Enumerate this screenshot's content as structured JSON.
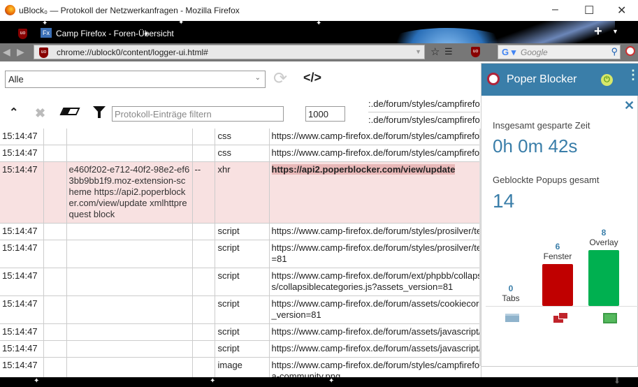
{
  "window": {
    "title": "uBlock₀ — Protokoll der Netzwerkanfragen - Mozilla Firefox",
    "minimize": "–",
    "maximize": "☐",
    "close": "✕"
  },
  "tab": {
    "label": "Camp Firefox - Foren-Übersicht",
    "new_tab": "+"
  },
  "navbar": {
    "url": "chrome://ublock0/content/logger-ui.html#",
    "search_placeholder": "Google"
  },
  "logger": {
    "select_value": "Alle",
    "filter_placeholder": "Protokoll-Einträge filtern",
    "max_entries": "1000",
    "partial_urls": [
      ":.de/forum/styles/campfirefox",
      ":.de/forum/styles/campfirefox"
    ],
    "rows": [
      {
        "time": "15:14:47",
        "context": "",
        "flag": "",
        "type": "css",
        "url": "https://www.camp-firefox.de/forum/styles/campfirefox",
        "blocked": false
      },
      {
        "time": "15:14:47",
        "context": "",
        "flag": "",
        "type": "css",
        "url": "https://www.camp-firefox.de/forum/styles/campfirefox",
        "blocked": false
      },
      {
        "time": "15:14:47",
        "context": "e460f202-e712-40f2-98e2-ef63bb9bb1f9.moz-extension-scheme https://api2.poperblocker.com/view/update xmlhttprequest block",
        "flag": "--",
        "type": "xhr",
        "url": "https://api2.poperblocker.com/view/update",
        "blocked": true
      },
      {
        "time": "15:14:47",
        "context": "",
        "flag": "",
        "type": "script",
        "url": "https://www.camp-firefox.de/forum/styles/prosilver/te",
        "blocked": false
      },
      {
        "time": "15:14:47",
        "context": "",
        "flag": "",
        "type": "script",
        "url": "https://www.camp-firefox.de/forum/styles/prosilver/te\n=81",
        "blocked": false
      },
      {
        "time": "15:14:47",
        "context": "",
        "flag": "",
        "type": "script",
        "url": "https://www.camp-firefox.de/forum/ext/phpbb/collaps\ns/collapsiblecategories.js?assets_version=81",
        "blocked": false
      },
      {
        "time": "15:14:47",
        "context": "",
        "flag": "",
        "type": "script",
        "url": "https://www.camp-firefox.de/forum/assets/cookiecor\n_version=81",
        "blocked": false
      },
      {
        "time": "15:14:47",
        "context": "",
        "flag": "",
        "type": "script",
        "url": "https://www.camp-firefox.de/forum/assets/javascript/",
        "blocked": false
      },
      {
        "time": "15:14:47",
        "context": "",
        "flag": "",
        "type": "script",
        "url": "https://www.camp-firefox.de/forum/assets/javascript/",
        "blocked": false
      },
      {
        "time": "15:14:47",
        "context": "",
        "flag": "",
        "type": "image",
        "url": "https://www.camp-firefox.de/forum/styles/campfirefo\na-community.png",
        "blocked": false
      }
    ]
  },
  "popup": {
    "title": "Poper Blocker",
    "close": "✕",
    "time_label": "Insgesamt gesparte Zeit",
    "time_value": "0h 0m 42s",
    "popups_label": "Geblockte Popups gesamt",
    "popups_value": "14",
    "colors": {
      "header": "#3a7ea9",
      "tabs": "#8fb3cc",
      "fenster": "#c00000",
      "overlay": "#00b050"
    },
    "chart_data": {
      "type": "bar",
      "categories": [
        "Tabs",
        "Fenster",
        "Overlay"
      ],
      "values": [
        0,
        6,
        8
      ],
      "labels": [
        "0",
        "6",
        "8"
      ]
    }
  }
}
